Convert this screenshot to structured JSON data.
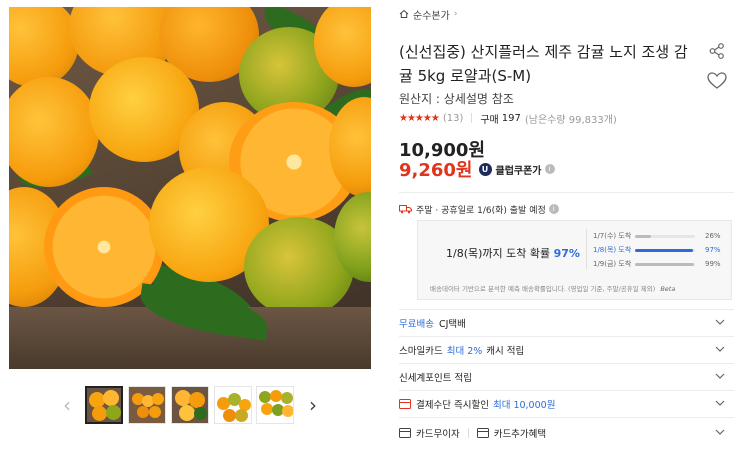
{
  "breadcrumb": {
    "home_icon": "home-icon",
    "label": "순수본가"
  },
  "product": {
    "title": "(신선집중) 산지플러스 제주 감귤 노지 조생 감귤 5kg 로얄과(S-M)",
    "origin": "원산지 : 상세설명 참조",
    "stars": "★★★★★",
    "rating": 4.8,
    "review_count": "(13)",
    "buy_label": "구매",
    "buy_count": "197",
    "stock": "(남은수량 99,833개)",
    "price": "10,900원",
    "sale_price": "9,260원",
    "coupon_badge": "U",
    "coupon_label": "클럽쿠폰가"
  },
  "shipping": {
    "header": "주말 · 공휴일로 1/6(화) 출발 예정",
    "prediction_main": "1/8(목)까지 도착 확률",
    "prediction_pct": "97%",
    "items": [
      {
        "date": "1/7(수) 도착",
        "pct": "26%",
        "value": 26,
        "highlight": false
      },
      {
        "date": "1/8(목) 도착",
        "pct": "97%",
        "value": 97,
        "highlight": true
      },
      {
        "date": "1/9(금) 도착",
        "pct": "99%",
        "value": 99,
        "highlight": false
      }
    ],
    "note": "배송데이터 기반으로 분석한 예측 배송확률입니다. (영업일 기준, 주말/공휴일 제외)",
    "beta": "Beta"
  },
  "options": {
    "free_ship": "무료배송",
    "courier": "CJ택배",
    "card_pre": "스마일카드",
    "card_blue": "최대 2%",
    "card_post": "캐시 적립",
    "shinsegae": "신세계포인트 적립",
    "pay_pre": "결제수단 즉시할인",
    "pay_blue": "최대 10,000원",
    "installment": "카드무이자",
    "card_benefit": "카드추가혜택"
  },
  "colors": {
    "accent_red": "#e0341d",
    "accent_blue": "#2f6bd6",
    "coupon_navy": "#1c2a5c"
  }
}
